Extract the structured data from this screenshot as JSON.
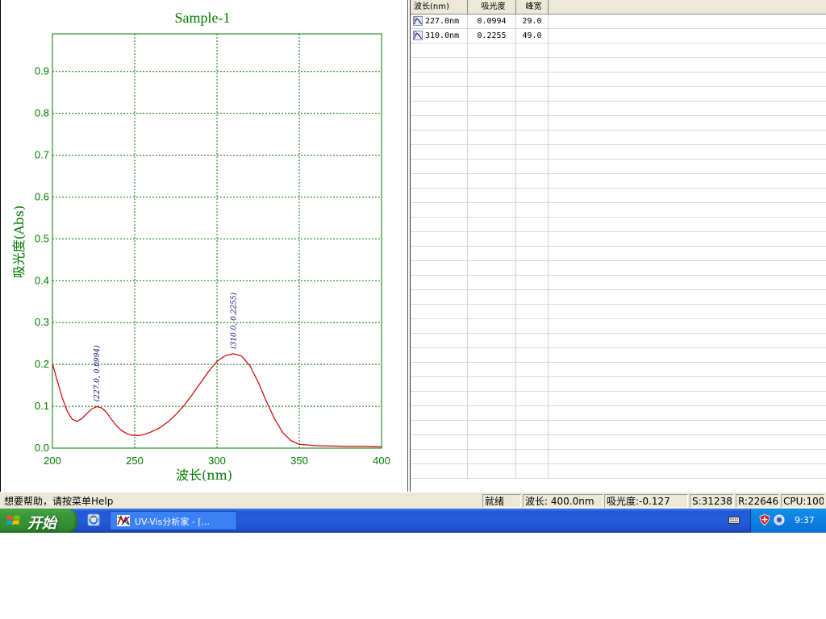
{
  "chart_data": {
    "type": "line",
    "title": "Sample-1",
    "xlabel": "波长(nm)",
    "ylabel": "吸光度(Abs)",
    "xlim": [
      200,
      400
    ],
    "ylim": [
      0.0,
      0.99
    ],
    "grid": true,
    "x_ticks": [
      "200",
      "250",
      "300",
      "350",
      "400"
    ],
    "y_ticks": [
      "0.0",
      "0.1",
      "0.2",
      "0.3",
      "0.4",
      "0.5",
      "0.6",
      "0.7",
      "0.8",
      "0.9"
    ],
    "series": [
      {
        "color": "#cc0000",
        "points": [
          [
            200,
            0.202
          ],
          [
            203,
            0.16
          ],
          [
            206,
            0.12
          ],
          [
            209,
            0.088
          ],
          [
            212,
            0.069
          ],
          [
            215,
            0.064
          ],
          [
            218,
            0.071
          ],
          [
            221,
            0.083
          ],
          [
            224,
            0.094
          ],
          [
            227,
            0.0994
          ],
          [
            230,
            0.096
          ],
          [
            233,
            0.085
          ],
          [
            236,
            0.068
          ],
          [
            239,
            0.053
          ],
          [
            242,
            0.042
          ],
          [
            245,
            0.035
          ],
          [
            248,
            0.031
          ],
          [
            251,
            0.03
          ],
          [
            254,
            0.031
          ],
          [
            257,
            0.034
          ],
          [
            260,
            0.039
          ],
          [
            265,
            0.048
          ],
          [
            270,
            0.062
          ],
          [
            275,
            0.08
          ],
          [
            280,
            0.102
          ],
          [
            285,
            0.128
          ],
          [
            290,
            0.156
          ],
          [
            295,
            0.184
          ],
          [
            300,
            0.207
          ],
          [
            305,
            0.221
          ],
          [
            310,
            0.2255
          ],
          [
            315,
            0.22
          ],
          [
            320,
            0.197
          ],
          [
            325,
            0.158
          ],
          [
            330,
            0.112
          ],
          [
            335,
            0.07
          ],
          [
            340,
            0.037
          ],
          [
            345,
            0.018
          ],
          [
            350,
            0.009
          ],
          [
            360,
            0.006
          ],
          [
            370,
            0.005
          ],
          [
            380,
            0.004
          ],
          [
            390,
            0.004
          ],
          [
            400,
            0.003
          ]
        ]
      }
    ],
    "annotations": [
      {
        "x": 227.0,
        "y": 0.0994,
        "text": "(227.0, 0.0994)"
      },
      {
        "x": 310.0,
        "y": 0.2255,
        "text": "(310.0, 0.2255)"
      }
    ]
  },
  "peak_table": {
    "headers": [
      "波长(nm)",
      "吸光度",
      "峰宽"
    ],
    "rows": [
      {
        "wavelength": "227.0nm",
        "absorbance": "0.0994",
        "width": "29.0"
      },
      {
        "wavelength": "310.0nm",
        "absorbance": "0.2255",
        "width": "49.0"
      }
    ]
  },
  "statusbar": {
    "help": "想要帮助，请按菜单Help",
    "ready": "就绪",
    "wavelength": "波长: 400.0nm",
    "absorbance": "吸光度:-0.127",
    "s": "S:31238",
    "r": "R:22646",
    "cpu": "CPU:100"
  },
  "taskbar": {
    "start_label": "开始",
    "task_label": "UV-Vis分析家 - [...",
    "clock": "9:37"
  },
  "colors": {
    "chart_green": "#007a00",
    "curve_red": "#cc0000",
    "annotation_blue": "#000080"
  }
}
